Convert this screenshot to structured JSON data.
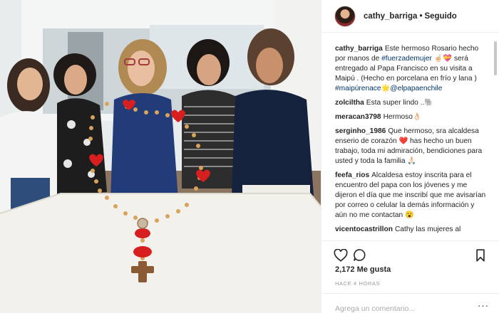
{
  "post": {
    "author": "cathy_barriga",
    "separator": "•",
    "follow_status": "Seguido"
  },
  "comments": [
    {
      "user": "cathy_barriga",
      "text_parts": [
        {
          "t": "Este hermoso Rosario hecho por manos de ",
          "tag": false
        },
        {
          "t": "#fuerzademujer",
          "tag": true
        },
        {
          "t": " ☝🏻💝 será entregado al Papa Francisco en su visita a Maipú . (Hecho en porcelana en frío y lana ) ",
          "tag": false
        },
        {
          "t": "#maipúrenace",
          "tag": true
        },
        {
          "t": "🌟",
          "tag": false
        },
        {
          "t": "@elpapaenchile",
          "tag": true
        }
      ]
    },
    {
      "user": "zolciltha",
      "text_parts": [
        {
          "t": "Esta super lindo ..🐘",
          "tag": false
        }
      ]
    },
    {
      "user": "meracan3798",
      "text_parts": [
        {
          "t": "Hermoso👌🏻",
          "tag": false
        }
      ]
    },
    {
      "user": "serginho_1986",
      "text_parts": [
        {
          "t": "Que hermoso, sra alcaldesa enserio de corazón ❤️ has hecho un buen trabajo, toda mi admiración, bendiciones para usted y toda la familia 🙏🏻",
          "tag": false
        }
      ]
    },
    {
      "user": "feefa_rios",
      "text_parts": [
        {
          "t": "Alcaldesa estoy inscrita para el encuentro del papa con los jóvenes y me dijeron el día que me inscribí que me avisarían por correo o celular la demás información y aún no me contactan 😮",
          "tag": false
        }
      ]
    },
    {
      "user": "vicentocastrillon",
      "text_parts": [
        {
          "t": "Cathy las mujeres al",
          "tag": false
        }
      ]
    }
  ],
  "actions": {
    "like_icon": "heart-icon",
    "comment_icon": "comment-bubble-icon",
    "save_icon": "bookmark-icon"
  },
  "likes_text": "2,172 Me gusta",
  "time_text": "HACE 4 HORAS",
  "add_comment": {
    "placeholder": "Agrega un comentario...",
    "more": "···"
  },
  "colors": {
    "hashtag": "#003569",
    "border": "#efefef",
    "muted": "#999999",
    "rosary_bead": "#d9a35a",
    "rosary_heart": "#d81f1f"
  }
}
